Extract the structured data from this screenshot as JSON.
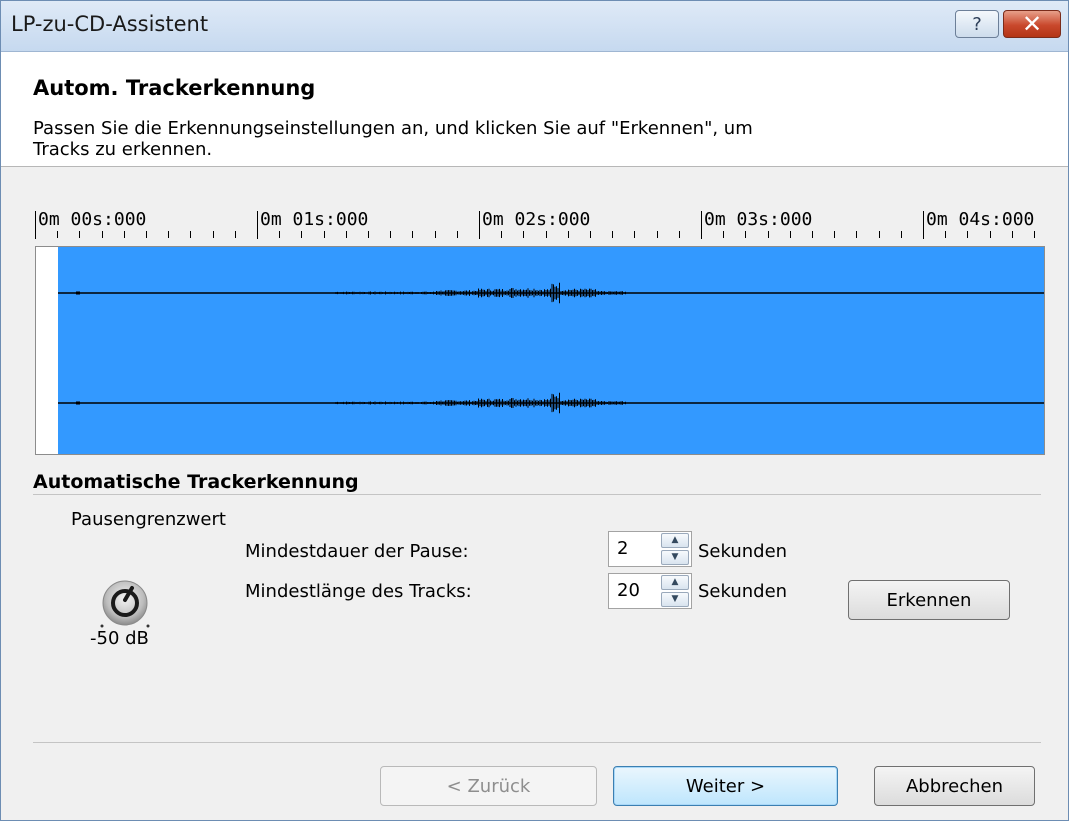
{
  "window": {
    "title": "LP-zu-CD-Assistent",
    "help_glyph": "?",
    "close_glyph": "✕"
  },
  "header": {
    "title": "Autom. Trackerkennung",
    "description": "Passen Sie die Erkennungseinstellungen an, und klicken Sie auf \"Erkennen\", um Tracks zu erkennen."
  },
  "timeline": {
    "labels": [
      "0m 00s:000",
      "0m 01s:000",
      "0m 02s:000",
      "0m 03s:000",
      "0m 04s:000"
    ]
  },
  "colors": {
    "waveform_background": "#3399ff",
    "waveform_signal": "#000000"
  },
  "detection": {
    "section_title": "Automatische Trackerkennung",
    "threshold_label": "Pausengrenzwert",
    "threshold_value": "-50 dB",
    "knob_icon": "rotary-knob-icon",
    "min_pause_label": "Mindestdauer der Pause:",
    "min_pause_value": "2",
    "min_track_label": "Mindestlänge des Tracks:",
    "min_track_value": "20",
    "unit": "Sekunden",
    "detect_button": "Erkennen"
  },
  "footer": {
    "back_button": "< Zurück",
    "next_button": "Weiter >",
    "cancel_button": "Abbrechen"
  }
}
